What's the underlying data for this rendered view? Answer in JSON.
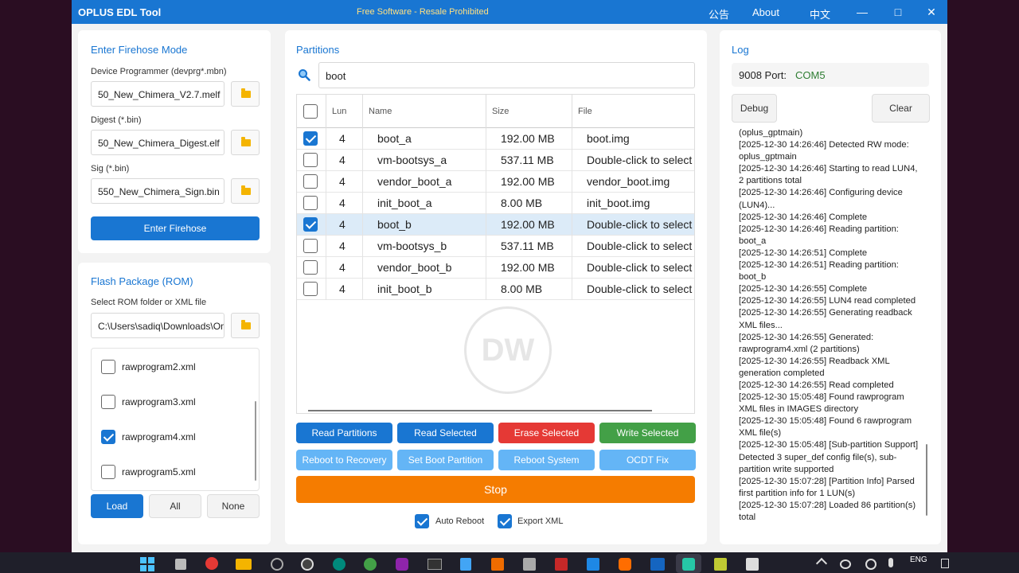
{
  "window": {
    "title": "OPLUS EDL Tool",
    "tagline": "Free Software - Resale Prohibited",
    "menu": [
      "公告",
      "About",
      "中文"
    ],
    "controls": [
      "—",
      "□",
      "✕"
    ]
  },
  "firehose": {
    "title": "Enter Firehose Mode",
    "programmer_label": "Device Programmer (devprg*.mbn)",
    "programmer_value": "50_New_Chimera_V2.7.melf",
    "digest_label": "Digest (*.bin)",
    "digest_value": "50_New_Chimera_Digest.elf",
    "sig_label": "Sig (*.bin)",
    "sig_value": "550_New_Chimera_Sign.bin",
    "enter_button": "Enter Firehose"
  },
  "flash": {
    "title": "Flash Package (ROM)",
    "select_label": "Select ROM folder or XML file",
    "path_value": "C:\\Users\\sadiq\\Downloads\\OnePlus",
    "files": [
      {
        "name": "rawprogram2.xml",
        "checked": false
      },
      {
        "name": "rawprogram3.xml",
        "checked": false
      },
      {
        "name": "rawprogram4.xml",
        "checked": true
      },
      {
        "name": "rawprogram5.xml",
        "checked": false
      }
    ],
    "load_button": "Load",
    "all_button": "All",
    "none_button": "None"
  },
  "partitions": {
    "title": "Partitions",
    "search_value": "boot",
    "columns": [
      "Lun",
      "Name",
      "Size",
      "File"
    ],
    "rows": [
      {
        "checked": true,
        "lun": "4",
        "name": "boot_a",
        "size": "192.00 MB",
        "file": "boot.img"
      },
      {
        "checked": false,
        "lun": "4",
        "name": "vm-bootsys_a",
        "size": "537.11 MB",
        "file": "Double-click to select"
      },
      {
        "checked": false,
        "lun": "4",
        "name": "vendor_boot_a",
        "size": "192.00 MB",
        "file": "vendor_boot.img"
      },
      {
        "checked": false,
        "lun": "4",
        "name": "init_boot_a",
        "size": "8.00 MB",
        "file": "init_boot.img"
      },
      {
        "checked": true,
        "lun": "4",
        "name": "boot_b",
        "size": "192.00 MB",
        "file": "Double-click to select"
      },
      {
        "checked": false,
        "lun": "4",
        "name": "vm-bootsys_b",
        "size": "537.11 MB",
        "file": "Double-click to select"
      },
      {
        "checked": false,
        "lun": "4",
        "name": "vendor_boot_b",
        "size": "192.00 MB",
        "file": "Double-click to select"
      },
      {
        "checked": false,
        "lun": "4",
        "name": "init_boot_b",
        "size": "8.00 MB",
        "file": "Double-click to select"
      }
    ],
    "watermark": "DW",
    "buttons_row1": [
      {
        "label": "Read Partitions",
        "color": "#1976d2"
      },
      {
        "label": "Read Selected",
        "color": "#1976d2"
      },
      {
        "label": "Erase Selected",
        "color": "#e53935"
      },
      {
        "label": "Write Selected",
        "color": "#43a047"
      }
    ],
    "buttons_row2": [
      {
        "label": "Reboot to Recovery",
        "color": "#64b5f6"
      },
      {
        "label": "Set Boot Partition",
        "color": "#64b5f6"
      },
      {
        "label": "Reboot System",
        "color": "#64b5f6"
      },
      {
        "label": "OCDT Fix",
        "color": "#64b5f6"
      }
    ],
    "stop_button": "Stop",
    "stop_color": "#f57c00",
    "auto_reboot_label": "Auto Reboot",
    "auto_reboot_checked": true,
    "export_xml_label": "Export XML",
    "export_xml_checked": true
  },
  "log": {
    "title": "Log",
    "port_label": "9008 Port:",
    "port_value": "COM5",
    "debug_button": "Debug",
    "clear_button": "Clear",
    "lines": [
      "(oplus_gptmain)",
      "[2025-12-30 14:26:46] Detected RW mode: oplus_gptmain",
      "[2025-12-30 14:26:46] Starting to read LUN4, 2 partitions total",
      "[2025-12-30 14:26:46] Configuring device (LUN4)...",
      "[2025-12-30 14:26:46] Complete",
      "[2025-12-30 14:26:46] Reading partition: boot_a",
      "[2025-12-30 14:26:51] Complete",
      "[2025-12-30 14:26:51] Reading partition: boot_b",
      "[2025-12-30 14:26:55] Complete",
      "[2025-12-30 14:26:55] LUN4 read completed",
      "[2025-12-30 14:26:55] Generating readback XML files...",
      "[2025-12-30 14:26:55]   Generated: rawprogram4.xml (2 partitions)",
      "[2025-12-30 14:26:55] Readback XML generation completed",
      "[2025-12-30 14:26:55] Read completed",
      "[2025-12-30 15:05:48] Found rawprogram XML files in IMAGES directory",
      "[2025-12-30 15:05:48] Found 6 rawprogram XML file(s)",
      "[2025-12-30 15:05:48] [Sub-partition Support] Detected 3 super_def config file(s), sub-partition write supported",
      "[2025-12-30 15:07:28] [Partition Info] Parsed first partition info for 1 LUN(s)",
      "[2025-12-30 15:07:28] Loaded 86 partition(s) total"
    ]
  },
  "taskbar": {
    "lang": "ENG"
  }
}
